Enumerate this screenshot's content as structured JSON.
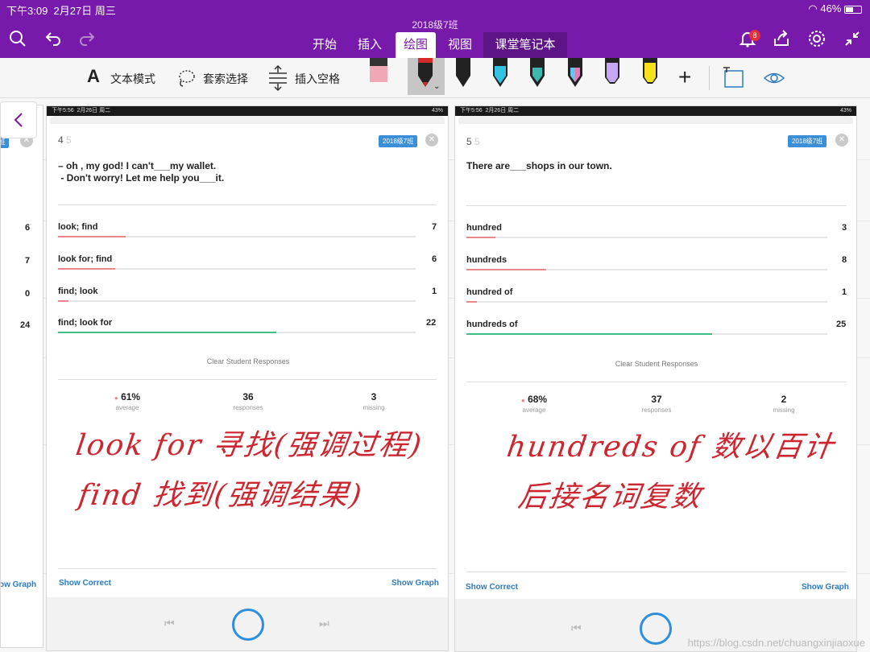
{
  "status_bar": {
    "time": "下午3:09",
    "date": "2月27日 周三",
    "battery": "46%"
  },
  "document_title": "2018级7班",
  "nav_tabs": [
    {
      "label": "开始"
    },
    {
      "label": "插入"
    },
    {
      "label": "绘图"
    },
    {
      "label": "视图"
    },
    {
      "label": "课堂笔记本"
    }
  ],
  "notification_count": "8",
  "ribbon": {
    "text_mode": "文本模式",
    "lasso": "套索选择",
    "insert_space": "插入空格"
  },
  "left_partial_counts": [
    "6",
    "7",
    "0",
    "24"
  ],
  "left_partial_link": "ow Graph",
  "left_partial_tag": "7班",
  "screenshots": [
    {
      "status_time": "下午5:56",
      "status_date": "2月26日 周二",
      "status_battery": "43%",
      "question_number": "4",
      "question_next": "5",
      "class_tag": "2018级7班",
      "question_line1": "– oh , my god! I can't___my wallet.",
      "question_line2": " - Don't worry! Let me help you___it.",
      "options": [
        {
          "label": "look; find",
          "count": "7",
          "fraction": 0.19,
          "color": "#e8888a"
        },
        {
          "label": "look for; find",
          "count": "6",
          "fraction": 0.16,
          "color": "#e8888a"
        },
        {
          "label": "find; look",
          "count": "1",
          "fraction": 0.03,
          "color": "#e8888a"
        },
        {
          "label": "find; look for",
          "count": "22",
          "fraction": 0.61,
          "color": "#3fbf85"
        }
      ],
      "clear_label": "Clear Student Responses",
      "average_value": "61%",
      "average_label": "average",
      "responses_value": "36",
      "responses_label": "responses",
      "missing_value": "3",
      "missing_label": "missing",
      "show_correct": "Show Correct",
      "show_graph": "Show Graph",
      "ink_line1": "look  for 寻找(强调过程)",
      "ink_line2": "find    找到(强调结果)"
    },
    {
      "status_time": "下午5:56",
      "status_date": "2月26日 周二",
      "status_battery": "43%",
      "question_number": "5",
      "question_next": "5",
      "class_tag": "2018级7班",
      "question_line1": "There are___shops in our town.",
      "question_line2": "",
      "options": [
        {
          "label": "hundred",
          "count": "3",
          "fraction": 0.08,
          "color": "#e8888a"
        },
        {
          "label": "hundreds",
          "count": "8",
          "fraction": 0.22,
          "color": "#e8888a"
        },
        {
          "label": "hundred of",
          "count": "1",
          "fraction": 0.03,
          "color": "#e8888a"
        },
        {
          "label": "hundreds of",
          "count": "25",
          "fraction": 0.68,
          "color": "#3fbf85"
        }
      ],
      "clear_label": "Clear Student Responses",
      "average_value": "68%",
      "average_label": "average",
      "responses_value": "37",
      "responses_label": "responses",
      "missing_value": "2",
      "missing_label": "missing",
      "show_correct": "Show Correct",
      "show_graph": "Show Graph",
      "ink_line1": "hundreds of 数以百计",
      "ink_line2": "后接名词复数"
    }
  ],
  "watermark": "https://blog.csdn.net/chuangxinjiaoxue"
}
